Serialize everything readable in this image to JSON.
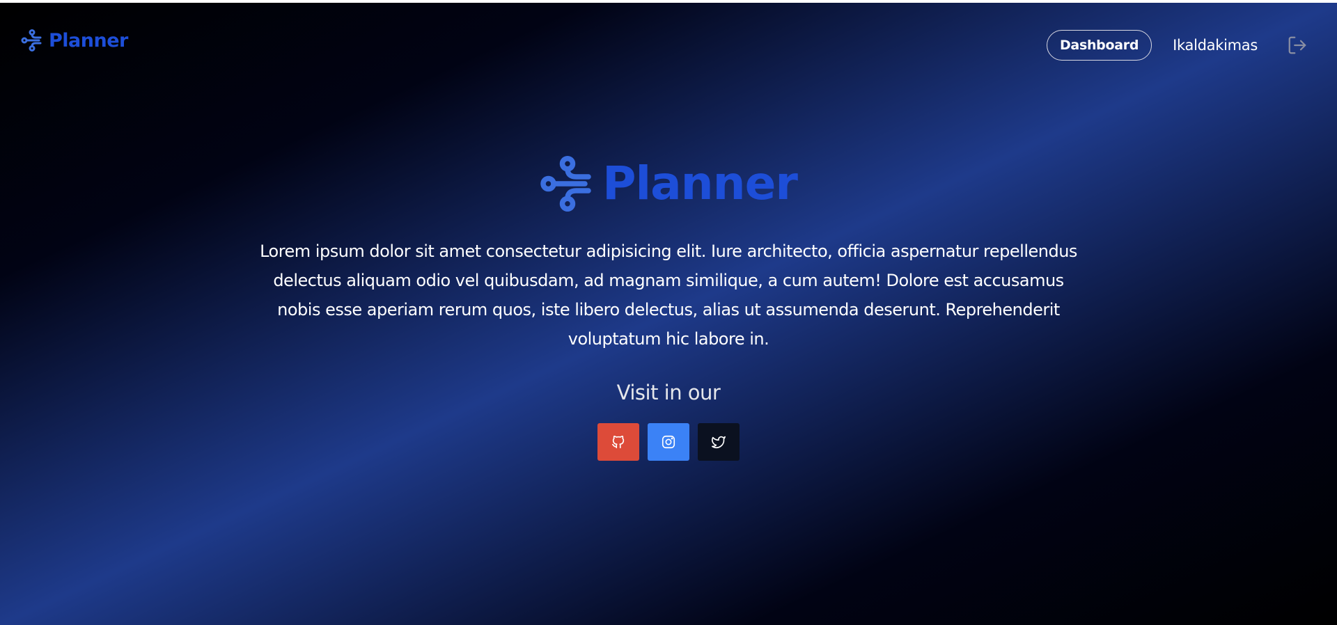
{
  "navbar": {
    "brand_text": "Planner",
    "dashboard_label": "Dashboard",
    "username": "Ikaldakimas",
    "logout_icon": "logout-icon"
  },
  "hero": {
    "title": "Planner",
    "description": "Lorem ipsum dolor sit amet consectetur adipisicing elit. Iure architecto, officia aspernatur repellendus delectus aliquam odio vel quibusdam, ad magnam similique, a cum autem! Dolore est accusamus nobis esse aperiam rerum quos, iste libero delectus, alias ut assumenda deserunt. Reprehenderit voluptatum hic labore in.",
    "visit_heading": "Visit in our"
  },
  "social": [
    {
      "name": "github",
      "icon": "github-icon",
      "color": "#dd4b39"
    },
    {
      "name": "instagram",
      "icon": "instagram-icon",
      "color": "#3b82f6"
    },
    {
      "name": "twitter",
      "icon": "twitter-icon",
      "color": "#0b1120"
    }
  ],
  "colors": {
    "brand": "#1d4ed8",
    "background_accent": "#1e3a8a",
    "text": "#ffffff"
  }
}
